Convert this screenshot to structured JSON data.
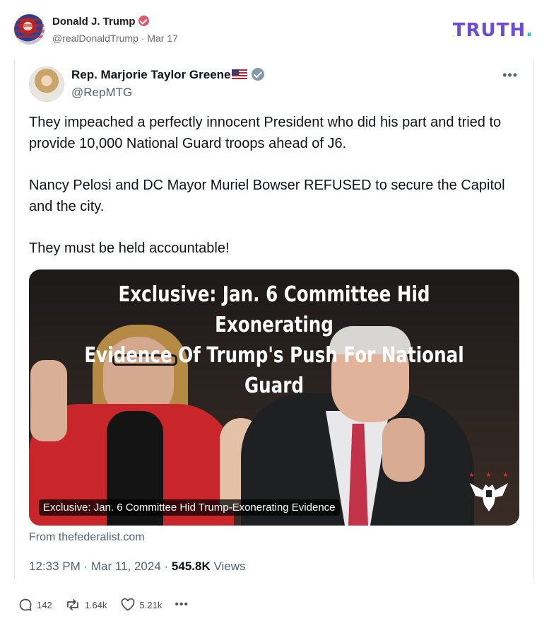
{
  "truth_post": {
    "author_name": "Donald J. Trump",
    "author_handle": "@realDonaldTrump",
    "date": "Mar 17",
    "separator": " · "
  },
  "brand": {
    "logo_text": "TRUTH",
    "logo_dot": ".",
    "logo_color": "#6b4bd8",
    "dot_color": "#25d0b5"
  },
  "embedded_post": {
    "author_name": "Rep. Marjorie Taylor Greene",
    "author_handle": "@RepMTG",
    "paragraphs": [
      "They impeached a perfectly innocent President who did his part and tried to provide 10,000 National Guard troops ahead of J6.",
      "Nancy Pelosi and DC Mayor Muriel Bowser REFUSED to secure the Capitol and the city.",
      "They must be held accountable!"
    ],
    "media": {
      "headline_line1": "Exclusive: Jan. 6 Committee Hid Exonerating",
      "headline_line2": "Evidence Of Trump's Push For National Guard",
      "caption": "Exclusive: Jan. 6 Committee Hid Trump-Exonerating Evidence"
    },
    "source": "From thefederalist.com",
    "time": "12:33 PM",
    "date": "Mar 11, 2024",
    "views_count": "545.8K",
    "views_label": "Views"
  },
  "actions": {
    "replies": "142",
    "retruths": "1.64k",
    "likes": "5.21k",
    "more": "•••"
  },
  "icons": {
    "reply": "speech-bubble-icon",
    "retruth": "repost-arrows-icon",
    "like": "heart-icon",
    "more": "ellipsis-icon",
    "verified": "verified-badge-icon"
  }
}
